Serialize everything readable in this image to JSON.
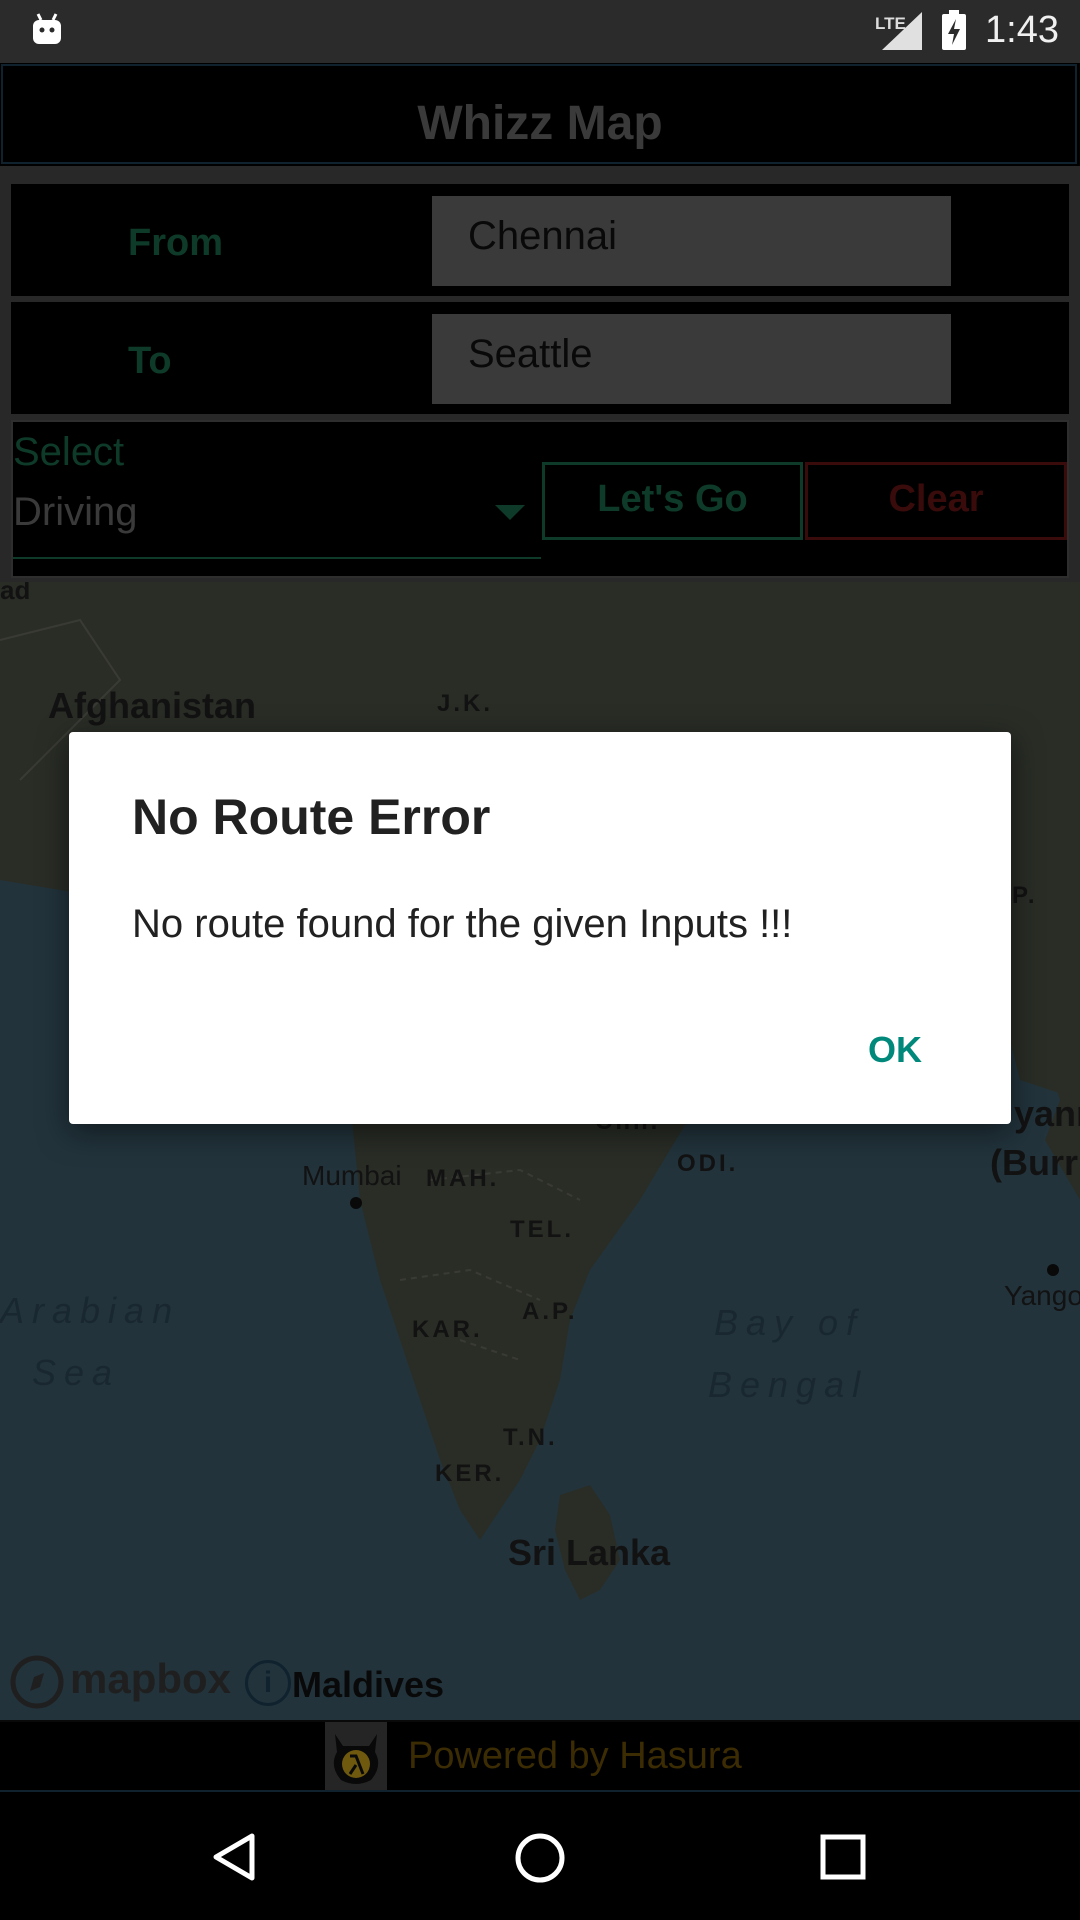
{
  "status_bar": {
    "network": "LTE",
    "time": "1:43"
  },
  "app": {
    "title": "Whizz Map"
  },
  "form": {
    "from_label": "From",
    "from_value": "Chennai",
    "to_label": "To",
    "to_value": "Seattle",
    "select_label": "Select",
    "select_value": "Driving",
    "go_label": "Let's Go",
    "clear_label": "Clear"
  },
  "map": {
    "labels": {
      "afghanistan": "Afghanistan",
      "jk": "J.K.",
      "mumbai": "Mumbai",
      "mah": "MAH.",
      "tel": "TEL.",
      "odi": "ODI.",
      "kar": "KAR.",
      "ap": "A.P.",
      "tn": "T.N.",
      "ker": "KER.",
      "sri_lanka": "Sri Lanka",
      "arabian": "Arabian",
      "sea": "Sea",
      "bay_of": "Bay of",
      "bengal": "Bengal",
      "myanmar_1": "yanr",
      "myanmar_2": "(Burr",
      "yangon": "Yango",
      "edge_ad": "ad",
      "edge_p": "P.",
      "chh": "Chh."
    },
    "attribution": {
      "mapbox": "mapbox",
      "info": "i",
      "maldives": "Maldives"
    }
  },
  "footer": {
    "powered_by": "Powered by Hasura"
  },
  "dialog": {
    "title": "No Route Error",
    "message": "No route found for the given Inputs !!!",
    "ok_label": "OK"
  },
  "colors": {
    "accent_green": "#1b6b4b",
    "clear_red": "#6b1414",
    "dialog_button": "#00897b",
    "footer_text": "#6e5006"
  }
}
